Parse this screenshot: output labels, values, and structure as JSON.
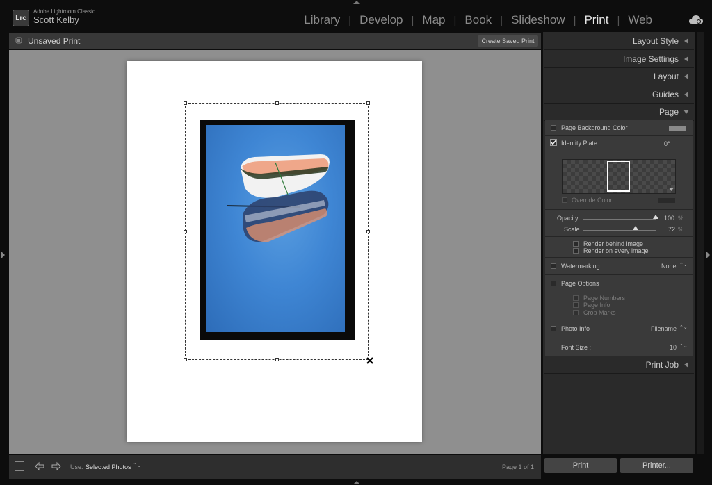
{
  "app": {
    "logo_text": "Lrc",
    "name": "Adobe Lightroom Classic",
    "user": "Scott Kelby"
  },
  "modules": [
    {
      "label": "Library",
      "active": false
    },
    {
      "label": "Develop",
      "active": false
    },
    {
      "label": "Map",
      "active": false
    },
    {
      "label": "Book",
      "active": false
    },
    {
      "label": "Slideshow",
      "active": false
    },
    {
      "label": "Print",
      "active": true
    },
    {
      "label": "Web",
      "active": false
    }
  ],
  "module_separator": "|",
  "center": {
    "title": "Unsaved Print",
    "create_saved_print": "Create Saved Print"
  },
  "toolbar": {
    "use_label": "Use:",
    "use_value": "Selected Photos",
    "use_arrows": "⌃⌄",
    "page_info": "Page 1 of 1"
  },
  "right_panel": {
    "sections": {
      "layout_style": "Layout Style",
      "image_settings": "Image Settings",
      "layout": "Layout",
      "guides": "Guides",
      "page": "Page",
      "print_job": "Print Job"
    },
    "page": {
      "page_background_color": {
        "label": "Page Background Color",
        "checked": false
      },
      "identity_plate": {
        "label": "Identity Plate",
        "checked": true,
        "angle": "0°"
      },
      "override_color": {
        "label": "Override Color",
        "checked": false
      },
      "opacity": {
        "label": "Opacity",
        "value": "100",
        "unit": "%",
        "fraction": 1.0
      },
      "scale": {
        "label": "Scale",
        "value": "72",
        "unit": "%",
        "fraction": 0.72
      },
      "render_behind_image": {
        "label": "Render behind image",
        "checked": false
      },
      "render_on_every_image": {
        "label": "Render on every image",
        "checked": false
      },
      "watermarking": {
        "label": "Watermarking :",
        "checked": false,
        "value": "None"
      },
      "page_options": {
        "label": "Page Options",
        "checked": false
      },
      "page_numbers": {
        "label": "Page Numbers",
        "checked": false
      },
      "page_info": {
        "label": "Page Info",
        "checked": false
      },
      "crop_marks": {
        "label": "Crop Marks",
        "checked": false
      },
      "photo_info": {
        "label": "Photo Info",
        "checked": false,
        "value": "Filename"
      },
      "font_size": {
        "label": "Font Size :",
        "value": "10"
      }
    },
    "select_arrows": "⌃⌄",
    "print_button": "Print",
    "printer_button": "Printer..."
  },
  "colors": {
    "accent": "#e6e6e6",
    "photo_blue": "#3f86d4",
    "canvas_gray": "#8f8f8f"
  },
  "icons": {
    "cloud": "cloud-sync-icon",
    "close": "close-x-icon",
    "prev": "arrow-left-icon",
    "next": "arrow-right-icon"
  }
}
